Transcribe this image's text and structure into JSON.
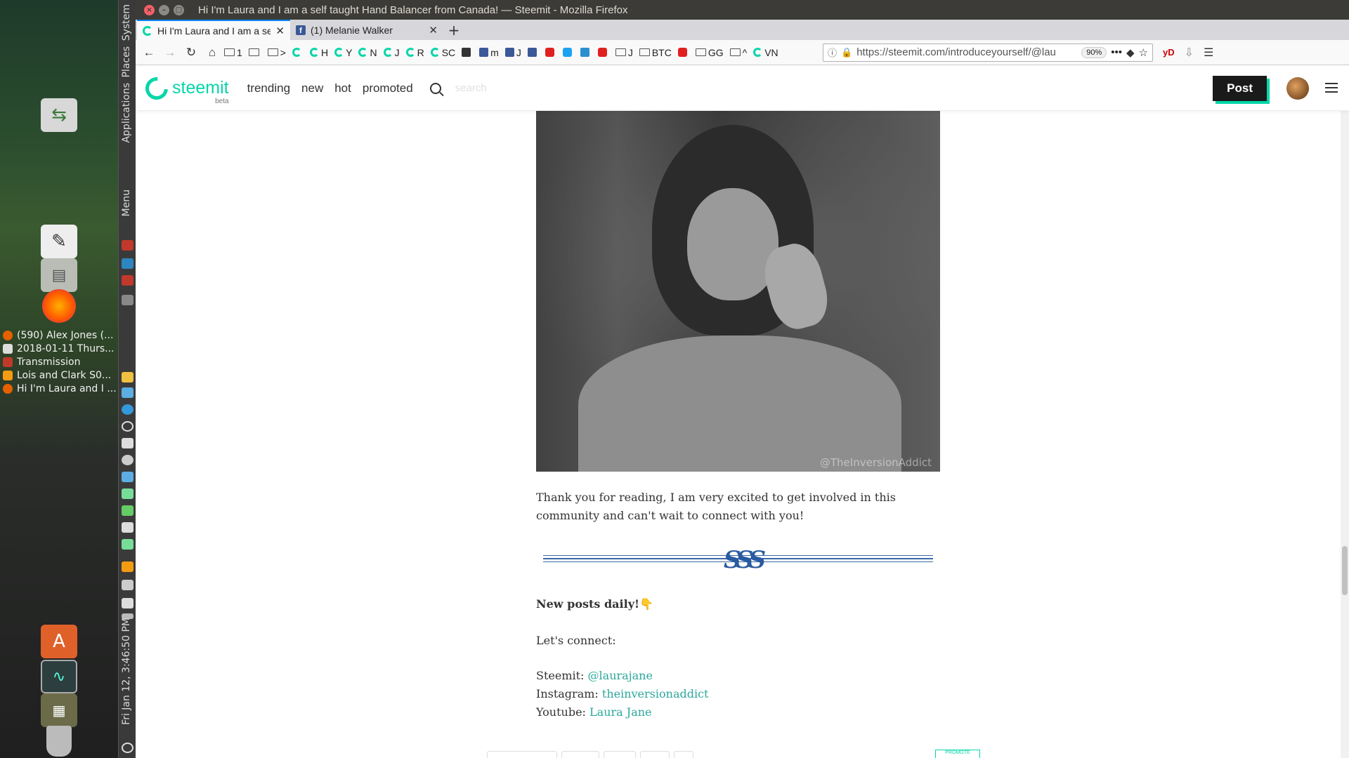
{
  "desktop": {
    "launchers": [
      "file-switch-icon",
      "text-editor-icon",
      "file-cabinet-icon",
      "firefox-icon",
      "software-center-icon",
      "system-monitor-icon",
      "workspace-switcher-icon",
      "trash-icon"
    ],
    "tasks": [
      {
        "label": "(590) Alex Jones (...",
        "color": "#e66000"
      },
      {
        "label": "2018-01-11 Thurs...",
        "color": "#dddddd"
      },
      {
        "label": "Transmission",
        "color": "#c0392b"
      },
      {
        "label": "Lois and Clark S0...",
        "color": "#f39c12"
      },
      {
        "label": "Hi I'm Laura and I ...",
        "color": "#e66000"
      }
    ],
    "panel": {
      "system": "System",
      "places": "Places",
      "applications": "Applications",
      "menu": "Menu",
      "clock": "Fri Jan 12,  3:46:50 PM"
    }
  },
  "window": {
    "title": "Hi I'm Laura and I am a self taught Hand Balancer from Canada! — Steemit - Mozilla Firefox"
  },
  "tabs": [
    {
      "label": "Hi I'm Laura and I am a se",
      "active": true
    },
    {
      "label": "(1) Melanie Walker",
      "active": false
    }
  ],
  "bookmarks": [
    {
      "icon": "folder",
      "label": "1"
    },
    {
      "icon": "folder",
      "label": ""
    },
    {
      "icon": "folder",
      "label": ">"
    },
    {
      "icon": "steem",
      "label": ""
    },
    {
      "icon": "steem",
      "label": "H"
    },
    {
      "icon": "steem",
      "label": "Y"
    },
    {
      "icon": "steem",
      "label": "N"
    },
    {
      "icon": "steem",
      "label": "J"
    },
    {
      "icon": "steem",
      "label": "R"
    },
    {
      "icon": "steem",
      "label": "SC"
    },
    {
      "icon": "dark",
      "label": ""
    },
    {
      "icon": "fb",
      "label": "m"
    },
    {
      "icon": "fb",
      "label": "J"
    },
    {
      "icon": "fb",
      "label": ""
    },
    {
      "icon": "red",
      "label": ""
    },
    {
      "icon": "blue",
      "label": ""
    },
    {
      "icon": "teal",
      "label": ""
    },
    {
      "icon": "red",
      "label": ""
    },
    {
      "icon": "folder",
      "label": "J"
    },
    {
      "icon": "folder",
      "label": "BTC"
    },
    {
      "icon": "red",
      "label": ""
    },
    {
      "icon": "folder",
      "label": "GG"
    },
    {
      "icon": "folder",
      "label": "^"
    },
    {
      "icon": "steem",
      "label": "VN"
    }
  ],
  "urlbar": {
    "url": "https://steemit.com/introduceyourself/@lau",
    "zoom": "90%"
  },
  "steemit": {
    "logo": "steemit",
    "beta": "beta",
    "nav": [
      "trending",
      "new",
      "hot",
      "promoted"
    ],
    "search_placeholder": "search",
    "post_label": "Post",
    "brand_color": "#06d6a9"
  },
  "article": {
    "photo_watermark": "@TheInversionAddict",
    "thanks": "Thank you for reading, I am very excited to get involved in this community and can't wait to connect with you!",
    "new_posts": "New posts daily!",
    "new_posts_emoji": "👇",
    "lets_connect": "Let's connect:",
    "social": [
      {
        "label": "Steemit:",
        "value": "@laurajane"
      },
      {
        "label": "Instagram:",
        "value": "theinversionaddict"
      },
      {
        "label": "Youtube:",
        "value": "Laura Jane"
      }
    ],
    "promote_label": "PROMOTE"
  }
}
